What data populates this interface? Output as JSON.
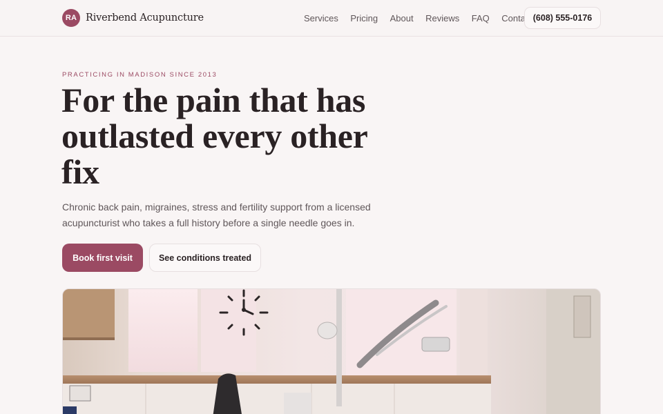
{
  "brand": {
    "initials": "RA",
    "name": "Riverbend Acupuncture"
  },
  "nav": {
    "items": [
      "Services",
      "Pricing",
      "About",
      "Reviews",
      "FAQ",
      "Contact"
    ]
  },
  "header": {
    "phone": "(608) 555-0176"
  },
  "hero": {
    "eyebrow": "PRACTICING IN MADISON SINCE 2013",
    "headline": "For the pain that has outlasted every other fix",
    "lede": "Chronic back pain, migraines, stress and fertility support from a licensed acupuncturist who takes a full history before a single needle goes in.",
    "primary_cta": "Book first visit",
    "secondary_cta": "See conditions treated"
  },
  "photo": {
    "subject": "treatment-room-photo"
  },
  "colors": {
    "accent": "#9b4a63",
    "background": "#f9f5f5",
    "text": "#2a2224",
    "muted": "#5f5659"
  }
}
